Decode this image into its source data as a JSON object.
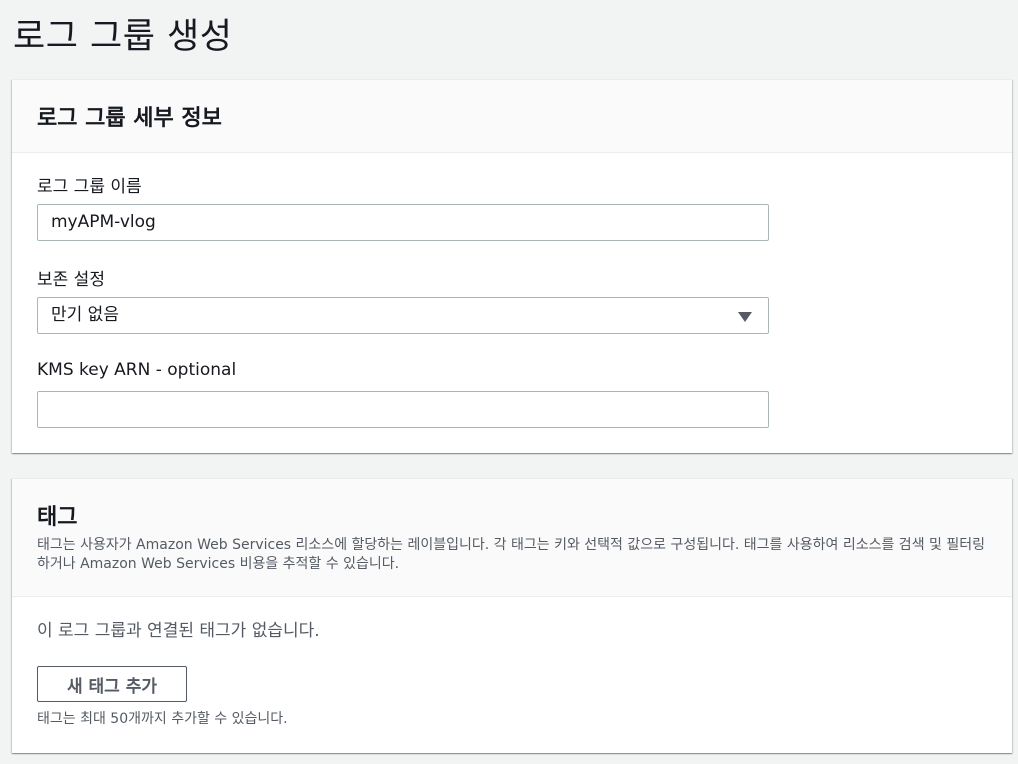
{
  "page": {
    "title": "로그 그룹 생성"
  },
  "details_panel": {
    "title": "로그 그룹 세부 정보",
    "log_group_name": {
      "label": "로그 그룹 이름",
      "value": "myAPM-vlog"
    },
    "retention": {
      "label": "보존 설정",
      "selected": "만기 없음"
    },
    "kms": {
      "label": "KMS key ARN - optional",
      "value": ""
    }
  },
  "tags_panel": {
    "title": "태그",
    "description": "태그는 사용자가 Amazon Web Services 리소스에 할당하는 레이블입니다. 각 태그는 키와 선택적 값으로 구성됩니다. 태그를 사용하여 리소스를 검색 및 필터링하거나 Amazon Web Services 비용을 추적할 수 있습니다.",
    "empty_text": "이 로그 그룹과 연결된 태그가 없습니다.",
    "add_button": "새 태그 추가",
    "hint": "태그는 최대 50개까지 추가할 수 있습니다."
  },
  "icons": {
    "retention_dropdown": "caret-down-icon"
  }
}
